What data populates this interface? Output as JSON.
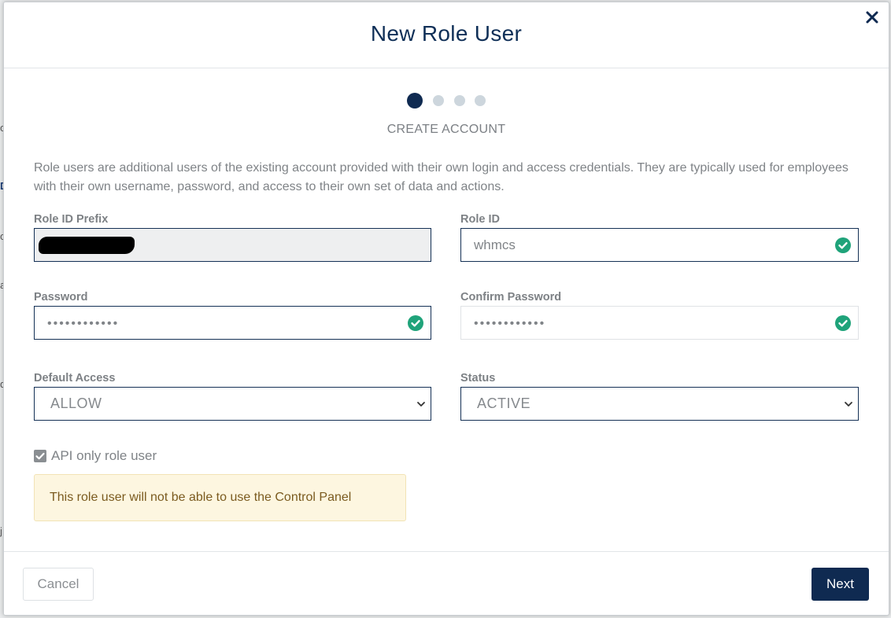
{
  "modal": {
    "title": "New Role User",
    "close_icon": "close-icon"
  },
  "stepper": {
    "total_steps": 4,
    "current_step": 1,
    "step_label": "CREATE ACCOUNT"
  },
  "description": "Role users are additional users of the existing account provided with their own login and access credentials. They are typically used for employees with their own username, password, and access to their own set of data and actions.",
  "fields": {
    "role_id_prefix": {
      "label": "Role ID Prefix",
      "value": ""
    },
    "role_id": {
      "label": "Role ID",
      "value": "whmcs",
      "valid": true
    },
    "password": {
      "label": "Password",
      "value": "••••••••••••",
      "valid": true
    },
    "confirm_password": {
      "label": "Confirm Password",
      "value": "••••••••••••",
      "valid": true
    },
    "default_access": {
      "label": "Default Access",
      "selected": "ALLOW"
    },
    "status": {
      "label": "Status",
      "selected": "ACTIVE"
    }
  },
  "api_only": {
    "label": "API only role user",
    "checked": true,
    "warning": "This role user will not be able to use the Control Panel"
  },
  "footer": {
    "cancel_label": "Cancel",
    "next_label": "Next"
  },
  "colors": {
    "primary": "#0f2a51",
    "valid": "#1fa37a",
    "warning_bg": "#fdf6e0"
  }
}
